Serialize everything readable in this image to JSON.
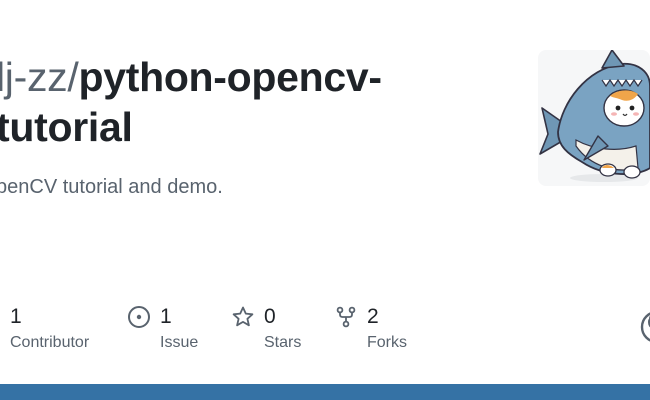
{
  "repo": {
    "owner": "lj-zz",
    "separator": "/",
    "name_line1": "python-opencv-",
    "name_line2": "tutorial",
    "description": "penCV tutorial and demo."
  },
  "stats": {
    "contributors": {
      "count": "1",
      "label": "Contributor"
    },
    "issues": {
      "count": "1",
      "label": "Issue"
    },
    "stars": {
      "count": "0",
      "label": "Stars"
    },
    "forks": {
      "count": "2",
      "label": "Forks"
    }
  },
  "icons": {
    "issue": "issue-opened-icon",
    "star": "star-icon",
    "fork": "repo-forked-icon",
    "github": "github-mark-icon"
  },
  "colors": {
    "language_bar": "#3572a5",
    "muted_text": "#59636e",
    "primary_text": "#1f2328"
  }
}
